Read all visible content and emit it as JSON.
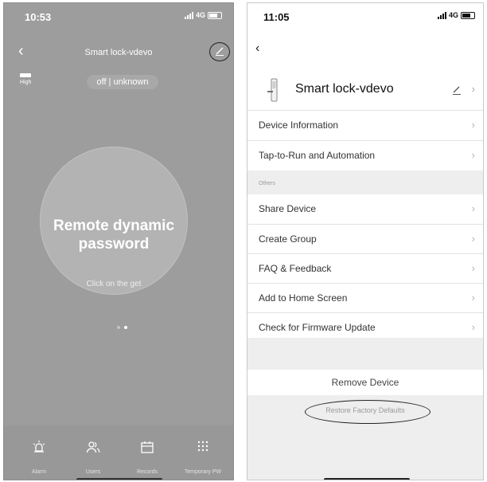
{
  "left_screen": {
    "status": {
      "time": "10:53",
      "network": "4G"
    },
    "header": {
      "title": "Smart lock-vdevo"
    },
    "battery_label": "High",
    "lock_status": "off | unknown",
    "main_action": {
      "title": "Remote dynamic password",
      "subtitle": "Click on the get"
    },
    "pager": {
      "pages": 2,
      "active": 2
    },
    "tabs": [
      {
        "label": "Alarm",
        "icon": "alarm-icon"
      },
      {
        "label": "Users",
        "icon": "users-icon"
      },
      {
        "label": "Records",
        "icon": "calendar-icon"
      },
      {
        "label": "Temporary PW",
        "icon": "keypad-icon"
      }
    ]
  },
  "right_screen": {
    "status": {
      "time": "11:05",
      "network": "4G"
    },
    "device": {
      "name": "Smart lock-vdevo"
    },
    "menu": [
      {
        "label": "Device Information"
      },
      {
        "label": "Tap-to-Run and Automation"
      }
    ],
    "others_section": {
      "header": "Others"
    },
    "others_menu": [
      {
        "label": "Share Device"
      },
      {
        "label": "Create Group"
      },
      {
        "label": "FAQ & Feedback"
      },
      {
        "label": "Add to Home Screen"
      },
      {
        "label": "Check for Firmware Update"
      }
    ],
    "remove_device": "Remove Device",
    "restore_factory": "Restore Factory Defaults"
  }
}
